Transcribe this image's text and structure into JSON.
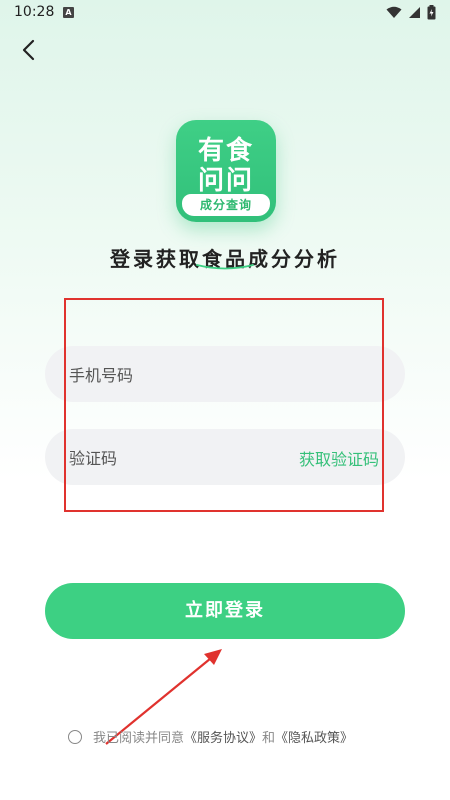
{
  "status_bar": {
    "time": "10:28",
    "notification_glyph": "A"
  },
  "header": {
    "back_icon": "chevron-left-icon"
  },
  "logo": {
    "line1": "有食",
    "line2": "问问",
    "tagline": "成分查询",
    "color": "#3fcf86"
  },
  "title": "登录获取食品成分分析",
  "form": {
    "phone_placeholder": "手机号码",
    "code_placeholder": "验证码",
    "get_code_label": "获取验证码"
  },
  "login_button": {
    "label": "立即登录",
    "color": "#3dd083"
  },
  "agreement": {
    "prefix": "我已阅读并同意",
    "service_link": "《服务协议》",
    "connector": "和",
    "privacy_link": "《隐私政策》"
  },
  "accent_color": "#35c079",
  "annotation_color": "#e0322e"
}
